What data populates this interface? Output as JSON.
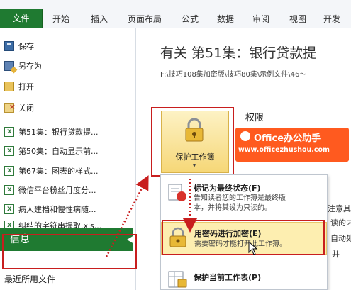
{
  "ribbon": {
    "tabs": [
      "文件",
      "开始",
      "插入",
      "页面布局",
      "公式",
      "数据",
      "审阅",
      "视图",
      "开发"
    ]
  },
  "sidebar": {
    "items": [
      {
        "label": "保存",
        "icon": "save-icon"
      },
      {
        "label": "另存为",
        "icon": "save-as-icon"
      },
      {
        "label": "打开",
        "icon": "open-folder-icon"
      },
      {
        "label": "关闭",
        "icon": "close-folder-icon"
      }
    ],
    "recent_files": [
      "第51集：银行贷款提...",
      "第50集：自动显示前...",
      "第67集：图表的样式...",
      "微信平台粉丝月度分...",
      "病人建档和慢性病随...",
      "纠结的字符串提取.xls..."
    ],
    "info_label": "信息",
    "recent_label": "最近所用文件"
  },
  "main": {
    "title": "有关 第51集：银行贷款提",
    "path": "F:\\技巧108集加密版\\技巧80集\\示例文件\\46～",
    "section_title": "权限",
    "protect_button_label": "保护工作簿",
    "protect_button_chevron": "▾"
  },
  "watermark": {
    "name": "Office办公助手",
    "url": "www.officezhushou.com"
  },
  "dropdown": {
    "items": [
      {
        "title": "标记为最终状态(F)",
        "desc": [
          "告知读者您的工作簿是最终版",
          "本，并将其设为只读的。"
        ]
      },
      {
        "title": "用密码进行加密(E)",
        "desc": [
          "需要密码才能打开此工作簿。"
        ]
      },
      {
        "title": "保护当前工作表(P)",
        "desc": []
      }
    ]
  },
  "background_peek": [
    "注意其",
    "读的内",
    "自动处",
    "并"
  ],
  "colors": {
    "file_tab": "#1f7a31",
    "highlight_frame": "#c81e1e",
    "watermark_bg": "#ff5a1f",
    "selected_item": "#fdeeb0"
  }
}
